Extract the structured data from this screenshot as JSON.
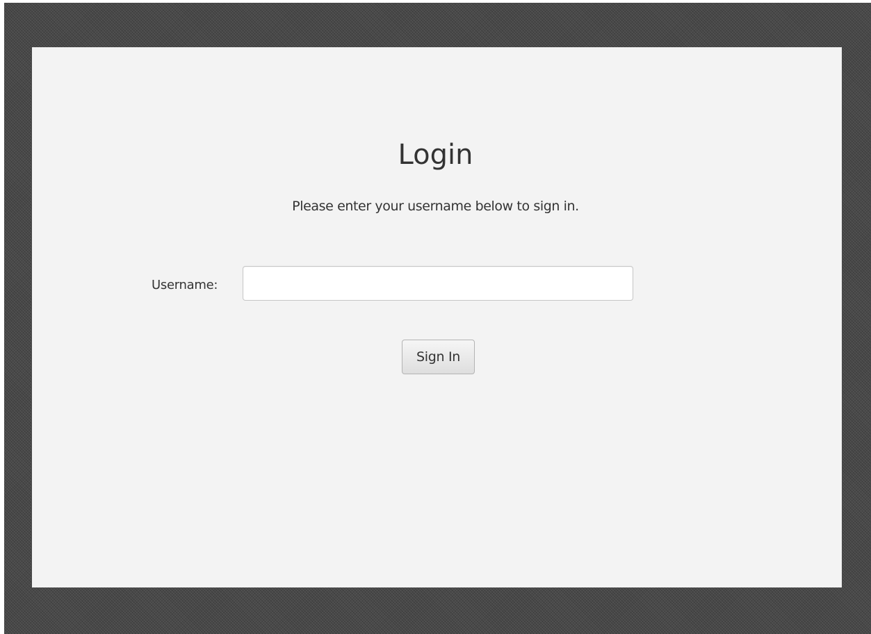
{
  "login": {
    "title": "Login",
    "subtitle": "Please enter your username below to sign in.",
    "username_label": "Username:",
    "username_value": "",
    "username_placeholder": "",
    "signin_label": "Sign In"
  },
  "colors": {
    "frame_background": "#4a4a4a",
    "panel_background": "#f3f3f3",
    "text": "#333333"
  }
}
